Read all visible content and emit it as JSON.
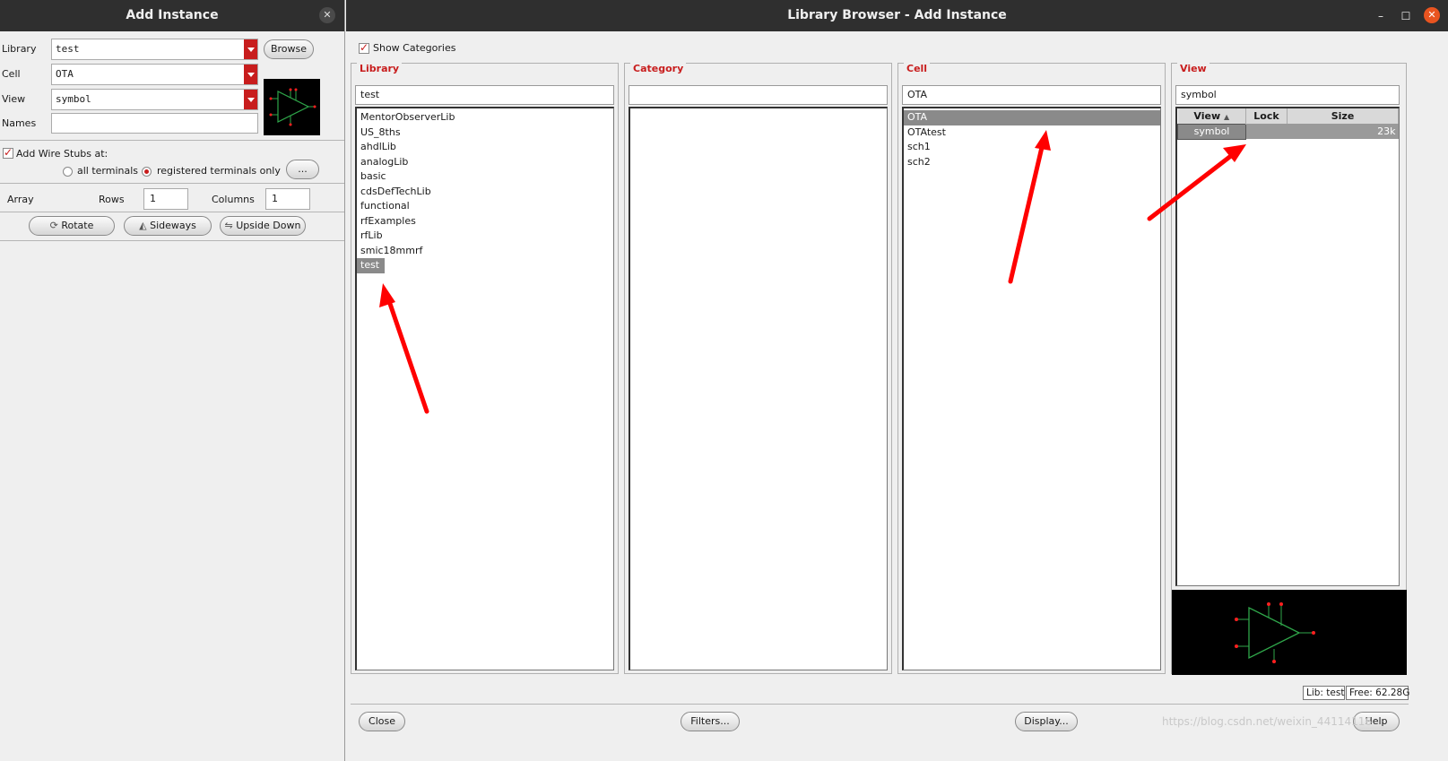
{
  "add_instance": {
    "title": "Add Instance",
    "library_label": "Library",
    "library_value": "test",
    "cell_label": "Cell",
    "cell_value": "OTA",
    "view_label": "View",
    "view_value": "symbol",
    "names_label": "Names",
    "names_value": "",
    "browse_label": "Browse",
    "wire_stubs_label": "Add Wire Stubs at:",
    "all_terminals_label": "all terminals",
    "registered_terminals_label": "registered terminals only",
    "more_label": "...",
    "array_label": "Array",
    "rows_label": "Rows",
    "rows_value": "1",
    "columns_label": "Columns",
    "columns_value": "1",
    "rotate_label": "Rotate",
    "sideways_label": "Sideways",
    "upside_down_label": "Upside Down"
  },
  "browser": {
    "title": "Library Browser - Add Instance",
    "show_categories_label": "Show Categories",
    "library": {
      "title": "Library",
      "filter": "test",
      "items": [
        "MentorObserverLib",
        "US_8ths",
        "ahdlLib",
        "analogLib",
        "basic",
        "cdsDefTechLib",
        "functional",
        "rfExamples",
        "rfLib",
        "smic18mmrf",
        "test"
      ],
      "selected": "test"
    },
    "category": {
      "title": "Category",
      "filter": ""
    },
    "cell": {
      "title": "Cell",
      "filter": "OTA",
      "items": [
        "OTA",
        "OTAtest",
        "sch1",
        "sch2"
      ],
      "selected": "OTA"
    },
    "view": {
      "title": "View",
      "filter": "symbol",
      "columns": [
        "View",
        "Lock",
        "Size"
      ],
      "rows": [
        {
          "view": "symbol",
          "lock": "",
          "size": "23k"
        }
      ]
    },
    "status_lib": "Lib: test",
    "status_free": "Free: 62.28G",
    "close_label": "Close",
    "filters_label": "Filters...",
    "display_label": "Display...",
    "help_label": "Help"
  },
  "watermark": "https://blog.csdn.net/weixin_44114116",
  "colors": {
    "accent": "#c81d1d",
    "titlebar": "#2f2f2f",
    "selection": "#8a8a8a",
    "annotation": "#ff0000",
    "symbol": "#2fa64a"
  }
}
